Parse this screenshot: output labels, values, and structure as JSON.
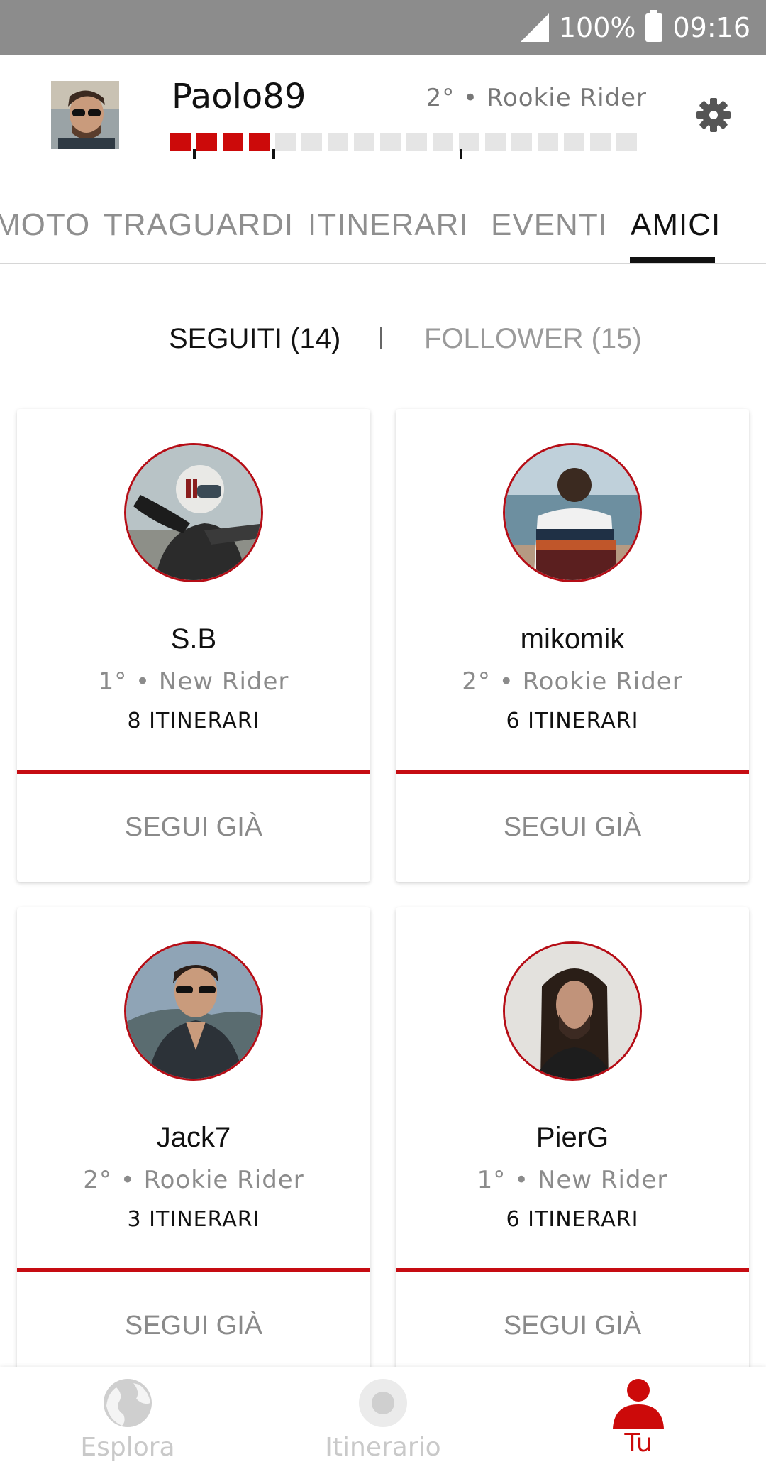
{
  "status": {
    "battery": "100%",
    "time": "09:16"
  },
  "profile": {
    "username": "Paolo89",
    "level": "2° •  Rookie Rider",
    "progress_filled_segments": 4,
    "progress_total_segments": 18
  },
  "tabs": [
    {
      "label": "MOTO"
    },
    {
      "label": "TRAGUARDI"
    },
    {
      "label": "ITINERARI"
    },
    {
      "label": "EVENTI"
    },
    {
      "label": "AMICI"
    }
  ],
  "subtabs": {
    "following": "SEGUITI (14)",
    "followers": "FOLLOWER (15)"
  },
  "friends": [
    {
      "name": "S.B",
      "rank": "1° •  New Rider",
      "routes": "8 ITINERARI",
      "button": "SEGUI GIÀ"
    },
    {
      "name": "mikomik",
      "rank": "2° •  Rookie Rider",
      "routes": "6 ITINERARI",
      "button": "SEGUI GIÀ"
    },
    {
      "name": "Jack7",
      "rank": "2° •  Rookie Rider",
      "routes": "3 ITINERARI",
      "button": "SEGUI GIÀ"
    },
    {
      "name": "PierG",
      "rank": "1° •  New Rider",
      "routes": "6 ITINERARI",
      "button": "SEGUI GIÀ"
    }
  ],
  "bottom_nav": [
    {
      "label": "Esplora",
      "icon": "globe-icon"
    },
    {
      "label": "Itinerario",
      "icon": "route-dot-icon"
    },
    {
      "label": "Tu",
      "icon": "person-icon"
    }
  ],
  "colors": {
    "accent": "#cc0a0a",
    "statusbar": "#8c8c8c",
    "inactive": "#8f8f8f"
  }
}
